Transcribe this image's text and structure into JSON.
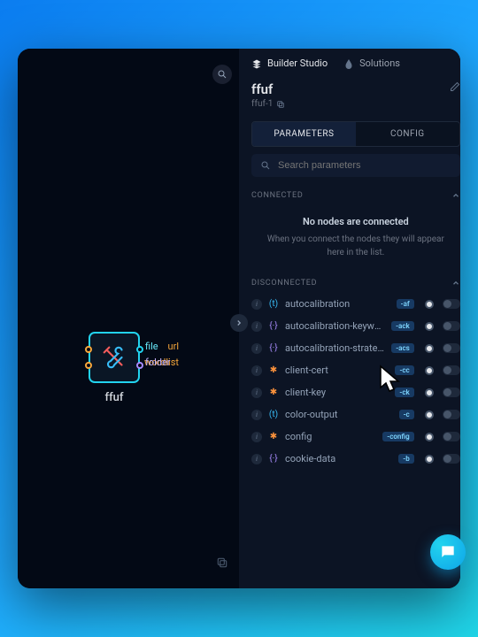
{
  "topTabs": {
    "builder": "Builder Studio",
    "solutions": "Solutions"
  },
  "title": "ffuf",
  "subtitle": "ffuf-1",
  "midTabs": {
    "params": "PARAMETERS",
    "config": "CONFIG"
  },
  "search": {
    "placeholder": "Search parameters"
  },
  "sections": {
    "connected": "CONNECTED",
    "disconnected": "DISCONNECTED"
  },
  "empty": {
    "title": "No nodes are connected",
    "desc": "When you connect the nodes they will appear here in the list."
  },
  "node": {
    "label": "ffuf",
    "ports": {
      "url": "url",
      "wordlist": "wordlist",
      "file": "file",
      "folder": "folder"
    }
  },
  "params": [
    {
      "kind": "text",
      "name": "autocalibration",
      "flag": "-af"
    },
    {
      "kind": "curly",
      "name": "autocalibration-keyword",
      "flag": "-ack"
    },
    {
      "kind": "curly",
      "name": "autocalibration-strategy",
      "flag": "-acs"
    },
    {
      "kind": "dot",
      "name": "client-cert",
      "flag": "-cc"
    },
    {
      "kind": "dot",
      "name": "client-key",
      "flag": "-ck"
    },
    {
      "kind": "text",
      "name": "color-output",
      "flag": "-c"
    },
    {
      "kind": "dot",
      "name": "config",
      "flag": "-config"
    },
    {
      "kind": "curly",
      "name": "cookie-data",
      "flag": "-b"
    }
  ]
}
